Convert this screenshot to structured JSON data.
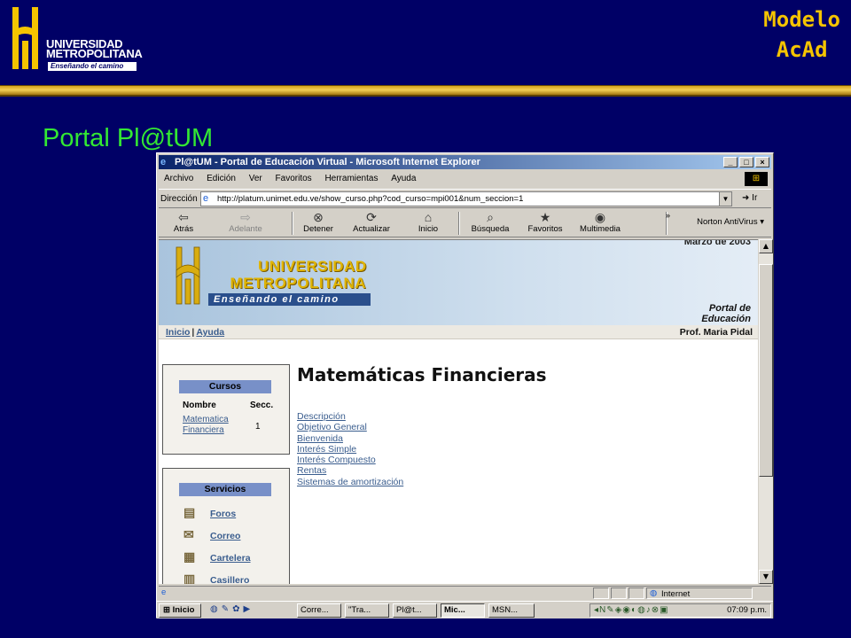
{
  "slide": {
    "university_lines": [
      "UNIVERSIDAD",
      "METROPOLITANA"
    ],
    "university_motto": "Enseñando el camino",
    "modelo_line1": "Modelo",
    "modelo_line2": "AcAd",
    "title": "Portal Pl@tUM"
  },
  "colors": {
    "slide_bg": "#000066",
    "accent_gold": "#f5c400",
    "title_green": "#33e833",
    "link_blue": "#3a5d8e"
  },
  "window": {
    "title": "Pl@tUM - Portal de Educación Virtual - Microsoft Internet Explorer",
    "menu": [
      "Archivo",
      "Edición",
      "Ver",
      "Favoritos",
      "Herramientas",
      "Ayuda"
    ],
    "address_label": "Dirección",
    "address_value": "http://platum.unimet.edu.ve/show_curso.php?cod_curso=mpi001&num_seccion=1",
    "go_label": "Ir",
    "toolbar": {
      "back": "Atrás",
      "forward": "Adelante",
      "stop": "Detener",
      "refresh": "Actualizar",
      "home": "Inicio",
      "search": "Búsqueda",
      "favorites": "Favoritos",
      "media": "Multimedia",
      "norton": "Norton AntiVirus"
    }
  },
  "page": {
    "date_fragment": "Marzo de 2003",
    "banner_lines": [
      "UNIVERSIDAD",
      "METROPOLITANA"
    ],
    "banner_motto": "Enseñando el camino",
    "portal_line1": "Portal de",
    "portal_line2": "Educación",
    "nav_inicio": "Inicio",
    "nav_ayuda": "Ayuda",
    "nav_sep": "|",
    "professor": "Prof. Maria Pidal",
    "cursos": {
      "heading": "Cursos",
      "col_name": "Nombre",
      "col_secc": "Secc.",
      "course_line1": "Matematica",
      "course_line2": "Financiera",
      "course_secc": "1"
    },
    "servicios": {
      "heading": "Servicios",
      "items": [
        "Foros",
        "Correo",
        "Cartelera",
        "Casillero"
      ]
    },
    "main_title": "Matemáticas Financieras",
    "topics": [
      "Descripción",
      "Objetivo General",
      "Bienvenida",
      "Interés Simple",
      "Interés Compuesto",
      "Rentas",
      "Sistemas de amortización"
    ]
  },
  "status": {
    "zone": "Internet"
  },
  "taskbar": {
    "start": "Inicio",
    "tasks": [
      "Corre...",
      "\"Tra...",
      "Pl@t...",
      "Mic...",
      "MSN..."
    ],
    "clock": "07:09 p.m."
  }
}
